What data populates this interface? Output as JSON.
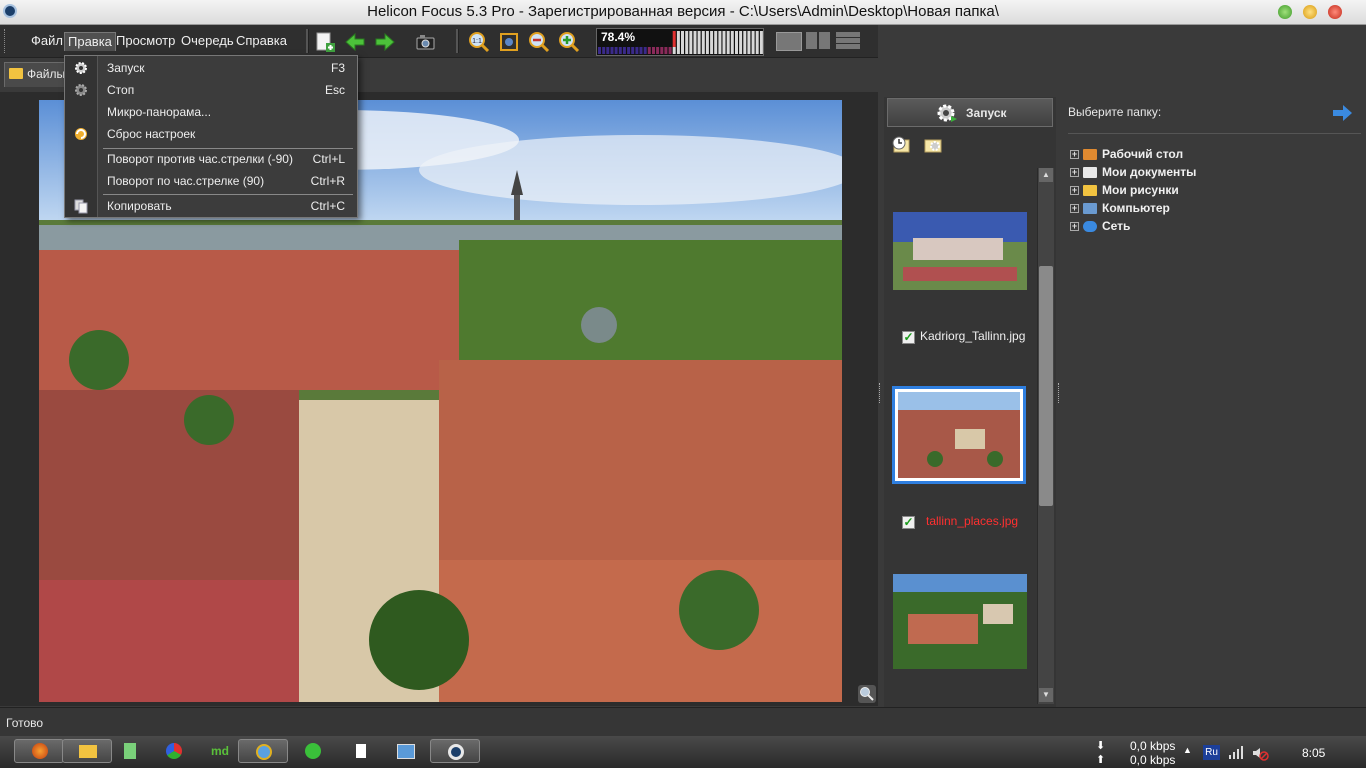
{
  "window": {
    "title": "Helicon Focus 5.3 Pro - Зарегистрированная версия - C:\\Users\\Admin\\Desktop\\Новая папка\\"
  },
  "menu": {
    "items": [
      "Файл",
      "Правка",
      "Просмотр",
      "Очередь",
      "Справка"
    ],
    "open": "Правка"
  },
  "toolbar": {
    "progress_text": "78.4%"
  },
  "tabs": {
    "files": "Файлы"
  },
  "edit_menu": {
    "items": [
      {
        "label": "Запуск",
        "shortcut": "F3",
        "icon": "gear-run-icon"
      },
      {
        "label": "Стоп",
        "shortcut": "Esc",
        "icon": "gear-stop-icon"
      },
      {
        "label": "Микро-панорама...",
        "shortcut": "",
        "icon": ""
      },
      {
        "label": "Сброс настроек",
        "shortcut": "",
        "icon": "reset-icon"
      },
      {
        "label": "Поворот против час.стрелки (-90)",
        "shortcut": "Ctrl+L",
        "icon": ""
      },
      {
        "label": "Поворот по час.стрелке (90)",
        "shortcut": "Ctrl+R",
        "icon": ""
      },
      {
        "label": "Копировать",
        "shortcut": "Ctrl+C",
        "icon": "copy-icon"
      }
    ]
  },
  "thumbnails": {
    "run_label": "Запуск",
    "items": [
      {
        "name": "Kadriorg_Tallinn.jpg",
        "checked": true,
        "selected": false
      },
      {
        "name": "tallinn_places.jpg",
        "checked": true,
        "selected": true
      },
      {
        "name": "",
        "checked": true,
        "selected": false
      }
    ]
  },
  "folders": {
    "prompt": "Выберите папку:",
    "tree": [
      "Рабочий стол",
      "Мои документы",
      "Мои рисунки",
      "Компьютер",
      "Сеть"
    ]
  },
  "status": {
    "text": "Готово"
  },
  "taskbar": {
    "net_down": "0,0 kbps",
    "net_up": "0,0 kbps",
    "lang": "Ru",
    "clock": "8:05"
  },
  "colors": {
    "accent": "#3a7fd5",
    "selected_label": "#ff3030",
    "progress_fill": "#7a1f5a"
  }
}
